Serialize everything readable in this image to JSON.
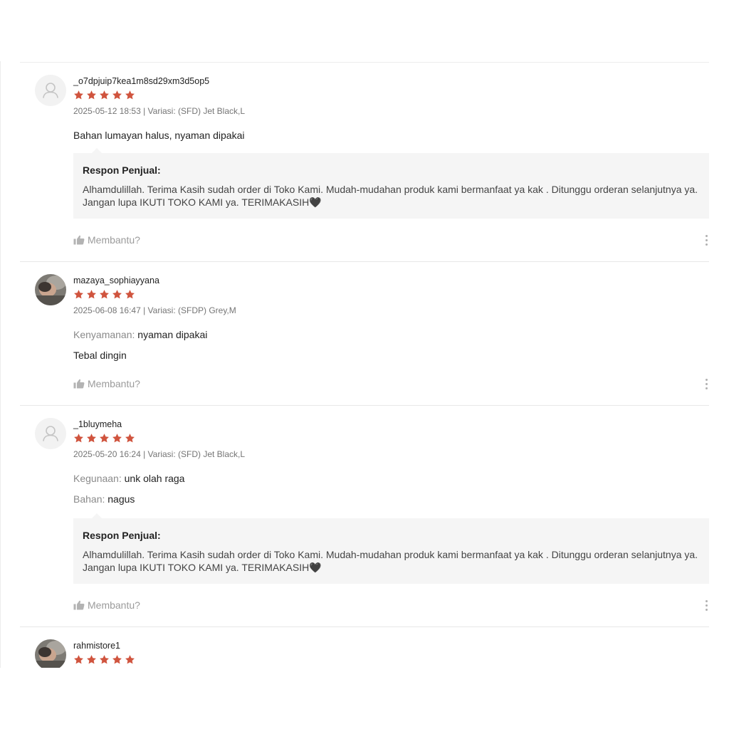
{
  "colors": {
    "star": "#d0543e",
    "response_bg": "#f5f5f5",
    "muted_text": "#757575"
  },
  "reviews": [
    {
      "username": "_o7dpjuip7kea1m8sd29xm3d5op5",
      "avatar": "default-user-icon",
      "rating": 5,
      "meta": "2025-05-12 18:53 | Variasi: (SFD) Jet Black,L",
      "attributes": [],
      "comment": "Bahan lumayan halus, nyaman dipakai",
      "response": {
        "title": "Respon Penjual:",
        "text": "Alhamdulillah. Terima Kasih sudah order di Toko Kami. Mudah-mudahan produk kami bermanfaat ya kak . Ditunggu orderan selanjutnya ya. Jangan lupa IKUTI TOKO KAMI ya. TERIMAKASIH🖤"
      },
      "helpful_label": "Membantu?"
    },
    {
      "username": "mazaya_sophiayyana",
      "avatar": "user-photo",
      "rating": 5,
      "meta": "2025-06-08 16:47 | Variasi: (SFDP) Grey,M",
      "attributes": [
        {
          "label": "Kenyamanan:",
          "value": "nyaman dipakai"
        }
      ],
      "comment": "Tebal dingin",
      "response": null,
      "helpful_label": "Membantu?"
    },
    {
      "username": "_1bluymeha",
      "avatar": "default-user-icon",
      "rating": 5,
      "meta": "2025-05-20 16:24 | Variasi: (SFD) Jet Black,L",
      "attributes": [
        {
          "label": "Kegunaan:",
          "value": "unk olah raga"
        },
        {
          "label": "Bahan:",
          "value": "nagus"
        }
      ],
      "comment": "",
      "response": {
        "title": "Respon Penjual:",
        "text": "Alhamdulillah. Terima Kasih sudah order di Toko Kami. Mudah-mudahan produk kami bermanfaat ya kak . Ditunggu orderan selanjutnya ya. Jangan lupa IKUTI TOKO KAMI ya. TERIMAKASIH🖤"
      },
      "helpful_label": "Membantu?"
    },
    {
      "username": "rahmistore1",
      "avatar": "user-photo",
      "rating": 5,
      "meta": "",
      "attributes": [],
      "comment": "",
      "response": null,
      "helpful_label": ""
    }
  ]
}
